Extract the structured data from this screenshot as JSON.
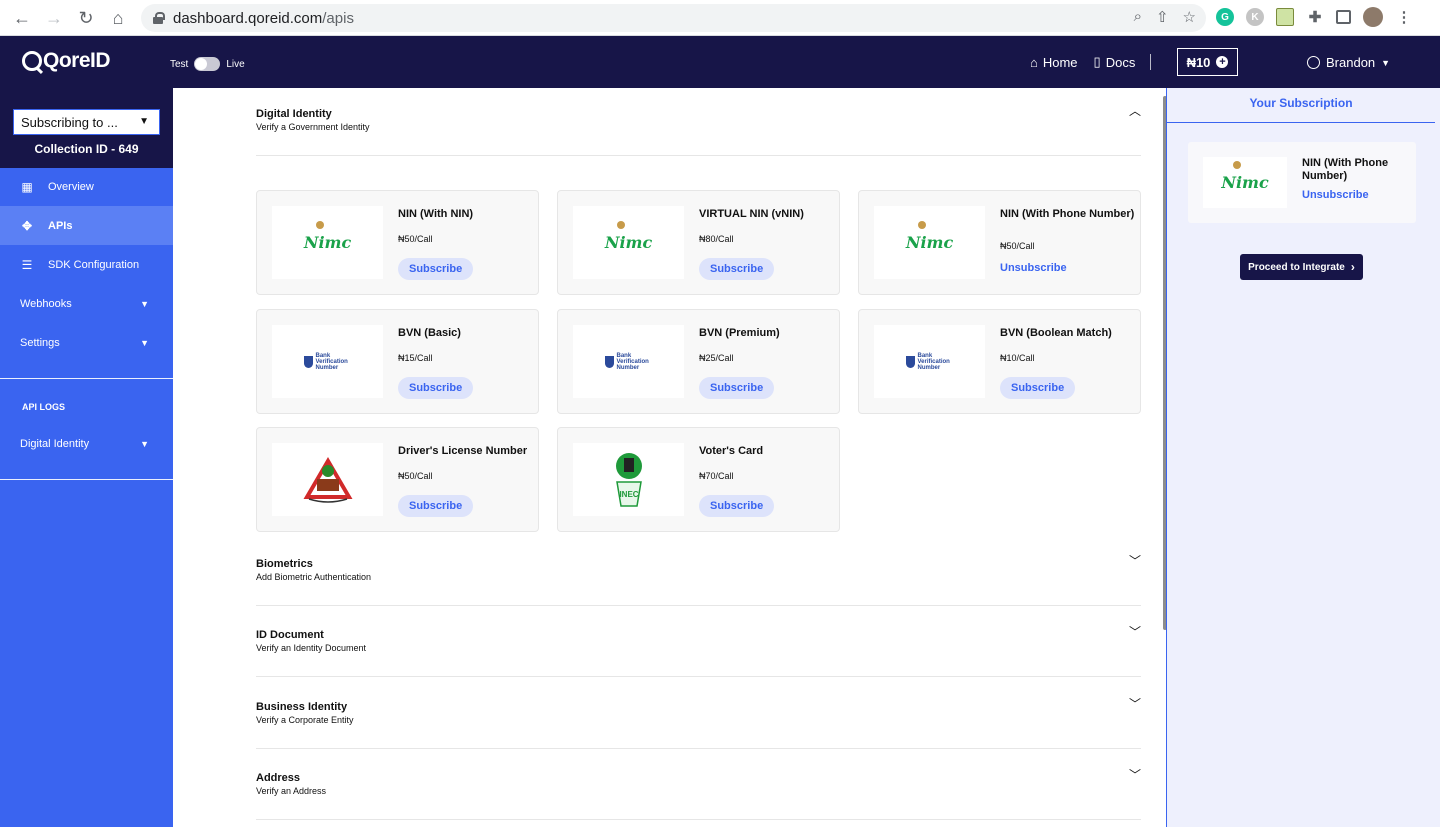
{
  "browser": {
    "url_host": "dashboard.qoreid.com",
    "url_path": "/apis"
  },
  "topbar": {
    "logo": "QoreID",
    "mode_test": "Test",
    "mode_live": "Live",
    "home": "Home",
    "docs": "Docs",
    "wallet": "₦10",
    "user": "Brandon"
  },
  "sidebar": {
    "subscribing_select": "Subscribing to ...",
    "collection_id": "Collection ID - 649",
    "items": [
      {
        "label": "Overview",
        "icon": "grid-icon"
      },
      {
        "label": "APIs",
        "icon": "move-icon"
      },
      {
        "label": "SDK Configuration",
        "icon": "sliders-icon"
      },
      {
        "label": "Webhooks"
      },
      {
        "label": "Settings"
      }
    ],
    "api_logs_label": "API LOGS",
    "logs_items": [
      {
        "label": "Digital Identity"
      }
    ]
  },
  "categories": [
    {
      "title": "Digital Identity",
      "subtitle": "Verify a Government Identity"
    },
    {
      "title": "Biometrics",
      "subtitle": "Add Biometric Authentication"
    },
    {
      "title": "ID Document",
      "subtitle": "Verify an Identity Document"
    },
    {
      "title": "Business Identity",
      "subtitle": "Verify a Corporate Entity"
    },
    {
      "title": "Address",
      "subtitle": "Verify an Address"
    }
  ],
  "products": [
    {
      "name": "NIN (With NIN)",
      "price": "₦50/Call",
      "action": "Subscribe",
      "logo": "Nimc"
    },
    {
      "name": "VIRTUAL NIN (vNIN)",
      "price": "₦80/Call",
      "action": "Subscribe",
      "logo": "Nimc"
    },
    {
      "name": "NIN (With Phone Number)",
      "price": "₦50/Call",
      "action": "Unsubscribe",
      "logo": "Nimc"
    },
    {
      "name": "BVN (Basic)",
      "price": "₦15/Call",
      "action": "Subscribe",
      "logo": "Bank Verification Number"
    },
    {
      "name": "BVN (Premium)",
      "price": "₦25/Call",
      "action": "Subscribe",
      "logo": "Bank Verification Number"
    },
    {
      "name": "BVN (Boolean Match)",
      "price": "₦10/Call",
      "action": "Subscribe",
      "logo": "Bank Verification Number"
    },
    {
      "name": "Driver's License Number",
      "price": "₦50/Call",
      "action": "Subscribe",
      "logo": "frsc-logo"
    },
    {
      "name": "Voter's Card",
      "price": "₦70/Call",
      "action": "Subscribe",
      "logo": "INEC"
    }
  ],
  "subscription": {
    "title": "Your Subscription",
    "item_name": "NIN (With Phone Number)",
    "item_logo": "Nimc",
    "item_action": "Unsubscribe",
    "proceed": "Proceed to Integrate"
  },
  "colors": {
    "sidebar": "#3a64f0",
    "navy": "#171548",
    "accent": "#3a64f0"
  }
}
